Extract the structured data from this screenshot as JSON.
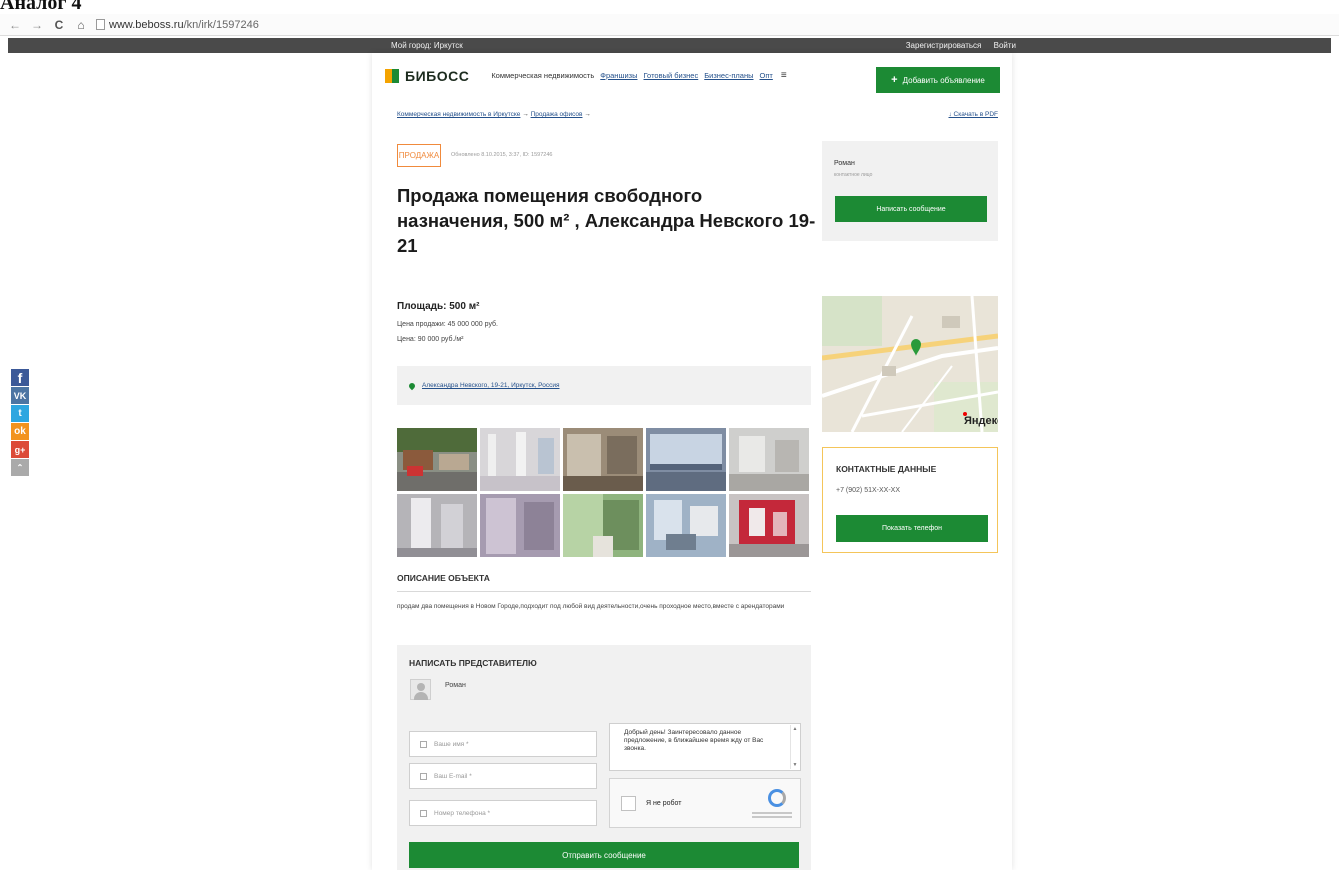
{
  "document": {
    "caption": "Аналог 4"
  },
  "browser": {
    "url_domain": "www.beboss.ru",
    "url_path": "/kn/irk/1597246"
  },
  "site_strip": {
    "city": "Мой город: Иркутск",
    "register": "Зарегистрироваться",
    "login": "Войти"
  },
  "header": {
    "logo": "БИБОСС",
    "nav": [
      "Коммерческая недвижимость",
      "Франшизы",
      "Готовый бизнес",
      "Бизнес-планы",
      "Опт"
    ],
    "add_button": "Добавить объявление"
  },
  "breadcrumbs": [
    "Коммерческая недвижимость в Иркутске",
    "Продажа офисов"
  ],
  "pdf_link": "↓ Скачать в PDF",
  "listing": {
    "badge": "ПРОДАЖА",
    "meta": "Обновлено 8.10.2015, 3:37, ID: 1597246",
    "title": "Продажа помещения свободного назначения, 500 м² , Александра Невского 19-21",
    "area": "Площадь: 500 м²",
    "price": "Цена продажи: 45 000 000 руб.",
    "price_per_m2": "Цена: 90 000 руб./м²",
    "address": "Александра Невского, 19-21, Иркутск, Россия"
  },
  "description": {
    "title": "ОПИСАНИЕ ОБЪЕКТА",
    "text": "продам два помещения в Новом Городе,подходит под любой вид деятельности,очень проходное место,вместе с арендаторами"
  },
  "contact_form": {
    "title": "НАПИСАТЬ ПРЕДСТАВИТЕЛЮ",
    "rep_name": "Роман",
    "name_placeholder": "Ваше имя *",
    "email_placeholder": "Ваш E-mail *",
    "phone_placeholder": "Номер телефона *",
    "message": "Добрый день! Заинтересовало данное предложение, в ближайшее время жду от Вас звонка.",
    "captcha_label": "Я не робот",
    "send_button": "Отправить сообщение"
  },
  "seller": {
    "name": "Роман",
    "role": "контактное лицо",
    "write_button": "Написать сообщение"
  },
  "map": {
    "provider": "Яндекс"
  },
  "contacts": {
    "title": "КОНТАКТНЫЕ ДАННЫЕ",
    "phone": "+7 (902) 51X-XX-XX",
    "show_phone_button": "Показать телефон"
  },
  "social": [
    "facebook-icon",
    "vk-icon",
    "twitter-icon",
    "odnoklassniki-icon",
    "google-plus-icon",
    "scroll-up-icon"
  ],
  "colors": {
    "brand_green": "#1c8a34",
    "sale_orange": "#f08a3c",
    "link_blue": "#24508b",
    "contacts_border": "#f4c55a"
  }
}
